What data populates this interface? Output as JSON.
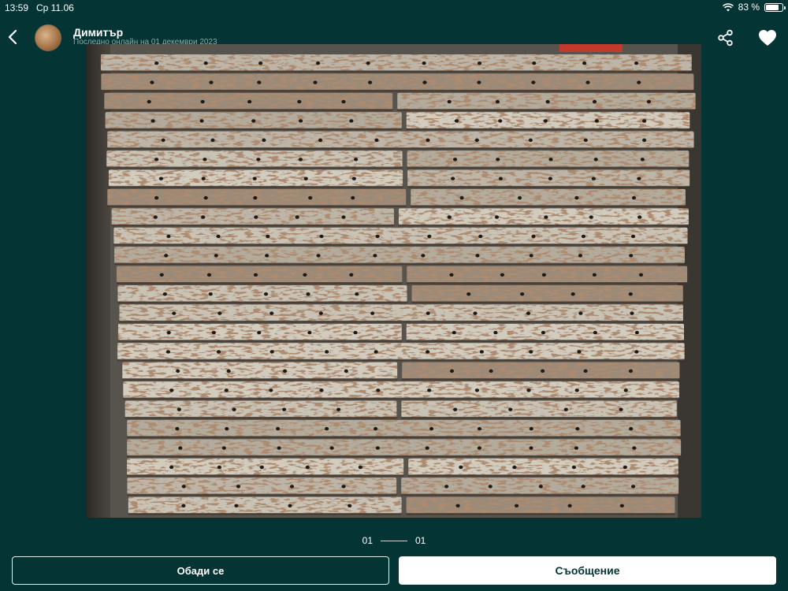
{
  "status_bar": {
    "time": "13:59",
    "date": "Ср 11.06",
    "battery_percent": "83 %",
    "battery_level": 0.83,
    "icons": [
      "wifi-icon",
      "battery-icon"
    ]
  },
  "header": {
    "back_icon": "chevron-left-icon",
    "user_name": "Димитър",
    "last_seen": "Последно онлайн на 01 декември 2023",
    "share_icon": "share-icon",
    "favorite_icon": "heart-icon"
  },
  "gallery": {
    "image_subject": "stack-of-rusty-formwork-panels",
    "current": "01",
    "total": "01"
  },
  "actions": {
    "call_label": "Обади се",
    "message_label": "Съобщение"
  },
  "colors": {
    "background": "#043534",
    "accent": "#ffffff"
  }
}
